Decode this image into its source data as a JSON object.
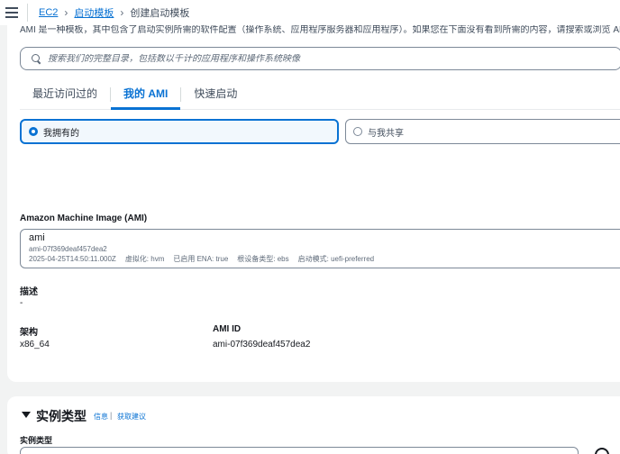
{
  "breadcrumb": {
    "items": [
      "EC2",
      "启动模板"
    ],
    "current": "创建启动模板"
  },
  "ami_section": {
    "description": "AMI 是一种模板，其中包含了启动实例所需的软件配置（操作系统、应用程序服务器和应用程序）。如果您在下面没有看到所需的内容，请搜索或浏览 AMI",
    "search_placeholder": "搜索我们的完整目录，包括数以千计的应用程序和操作系统映像",
    "tabs": [
      {
        "label": "最近访问过的",
        "active": false
      },
      {
        "label": "我的 AMI",
        "active": true
      },
      {
        "label": "快速启动",
        "active": false
      }
    ],
    "ownership": {
      "owned_label": "我拥有的",
      "shared_label": "与我共享",
      "selected": "owned"
    },
    "ami_label": "Amazon Machine Image (AMI)",
    "selected_ami": {
      "name": "ami",
      "id": "ami-07f369deaf457dea2",
      "created": "2025-04-25T14:50:11.000Z",
      "virtualization": "虚拟化: hvm",
      "ena": "已启用 ENA: true",
      "root_device": "根设备类型: ebs",
      "boot_mode": "启动模式: uefi-preferred"
    },
    "description_label": "描述",
    "description_value": "-",
    "arch_label": "架构",
    "arch_value": "x86_64",
    "ami_id_label": "AMI ID",
    "ami_id_value": "ami-07f369deaf457dea2"
  },
  "instance_type": {
    "title": "实例类型",
    "info_link": "信息",
    "separator": "|",
    "get_advice_link": "获取建议",
    "field_label": "实例类型"
  },
  "colors": {
    "accent": "#0972d3",
    "background": "#f2f3f3",
    "panel": "#ffffff",
    "border": "#7d8998"
  }
}
